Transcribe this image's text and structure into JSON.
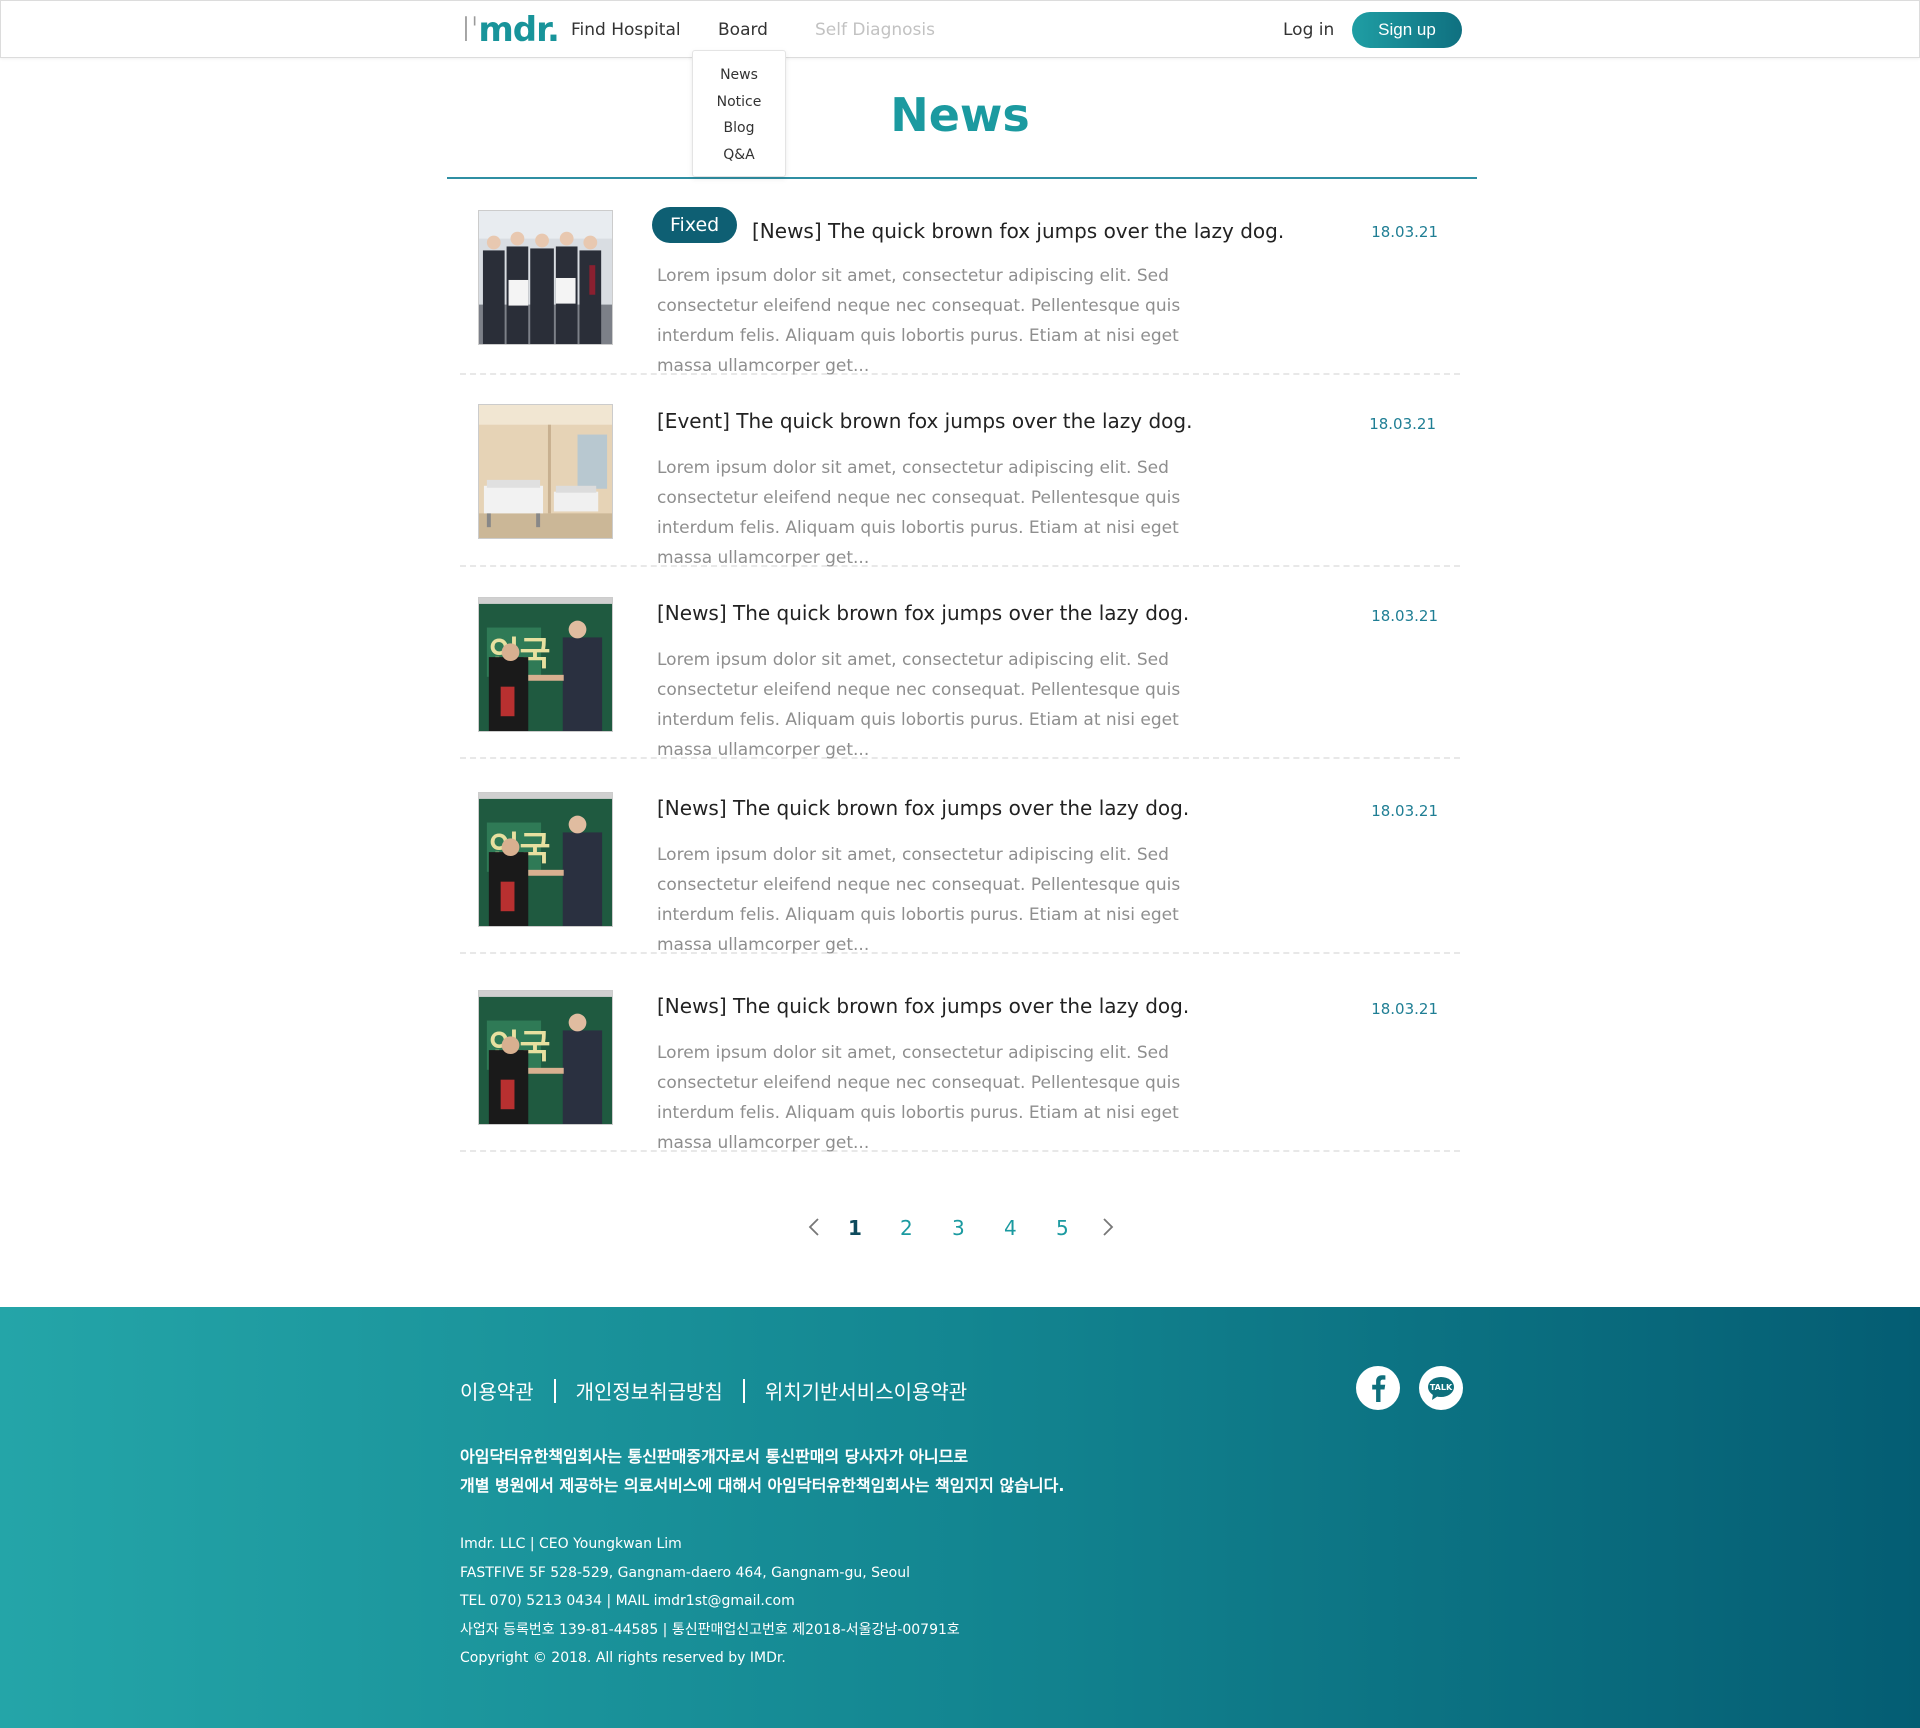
{
  "header": {
    "logo_i": "I'",
    "logo_mdr": "mdr.",
    "nav": {
      "find_hospital": "Find Hospital",
      "board": "Board",
      "self_diagnosis": "Self Diagnosis"
    },
    "login": "Log in",
    "signup": "Sign up"
  },
  "dropdown": {
    "items": [
      "News",
      "Notice",
      "Blog",
      "Q&A"
    ]
  },
  "page": {
    "title": "News"
  },
  "posts": [
    {
      "badge": "Fixed",
      "title": "[News] The quick brown fox jumps over the lazy dog.",
      "date": "18.03.21",
      "body": "Lorem ipsum dolor sit amet, consectetur adipiscing elit. Sed consectetur eleifend neque nec consequat. Pellentesque quis interdum felis. Aliquam quis lobortis purus. Etiam at nisi eget massa ullamcorper get...",
      "thumb": "group-photo"
    },
    {
      "badge": "",
      "title": "[Event] The quick brown fox jumps over the lazy dog.",
      "date": "18.03.21",
      "body": "Lorem ipsum dolor sit amet, consectetur adipiscing elit. Sed consectetur eleifend neque nec consequat. Pellentesque quis interdum felis. Aliquam quis lobortis purus. Etiam at nisi eget massa ullamcorper get...",
      "thumb": "hospital-room"
    },
    {
      "badge": "",
      "title": "[News] The quick brown fox jumps over the lazy dog.",
      "date": "18.03.21",
      "body": "Lorem ipsum dolor sit amet, consectetur adipiscing elit. Sed consectetur eleifend neque nec consequat. Pellentesque quis interdum felis. Aliquam quis lobortis purus. Etiam at nisi eget massa ullamcorper get...",
      "thumb": "handshake"
    },
    {
      "badge": "",
      "title": "[News] The quick brown fox jumps over the lazy dog.",
      "date": "18.03.21",
      "body": "Lorem ipsum dolor sit amet, consectetur adipiscing elit. Sed consectetur eleifend neque nec consequat. Pellentesque quis interdum felis. Aliquam quis lobortis purus. Etiam at nisi eget massa ullamcorper get...",
      "thumb": "handshake"
    },
    {
      "badge": "",
      "title": "[News] The quick brown fox jumps over the lazy dog.",
      "date": "18.03.21",
      "body": "Lorem ipsum dolor sit amet, consectetur adipiscing elit. Sed consectetur eleifend neque nec consequat. Pellentesque quis interdum felis. Aliquam quis lobortis purus. Etiam at nisi eget massa ullamcorper get...",
      "thumb": "handshake"
    }
  ],
  "pagination": {
    "pages": [
      "1",
      "2",
      "3",
      "4",
      "5"
    ],
    "active": "1"
  },
  "footer": {
    "links": [
      "이용약관",
      "개인정보취급방침",
      "위치기반서비스이용약관"
    ],
    "notice_line1": "아임닥터유한책임회사는 통신판매중개자로서 통신판매의 당사자가 아니므로",
    "notice_line2": "개별 병원에서 제공하는 의료서비스에 대해서 아임닥터유한책임회사는 책임지지 않습니다.",
    "info": [
      "Imdr. LLC | CEO Youngkwan Lim",
      "FASTFIVE 5F 528-529, Gangnam-daero 464, Gangnam-gu, Seoul",
      "TEL 070) 5213 0434 | MAIL  imdr1st@gmail.com",
      "사업자 등록번호 139-81-44585 | 통신판매업신고번호 제2018-서울강남-00791호",
      "Copyright © 2018. All rights reserved by IMDr."
    ],
    "social": {
      "kakao_label": "TALK"
    }
  },
  "colors": {
    "brand": "#1b9aa0",
    "brand_dark": "#0e5f73",
    "date": "#1f7e94",
    "footer_start": "#24a5a8",
    "footer_end": "#045d73"
  }
}
